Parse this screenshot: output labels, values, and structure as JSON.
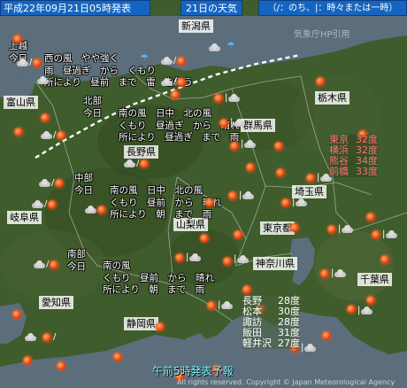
{
  "header": {
    "date": "平成22年09月21日05時発表",
    "day": "21日の天気",
    "legend": "（/：のち、|：時々または一時）"
  },
  "credit": "気象庁HP引用",
  "forecast_label": "午前5時発表予報",
  "copyright": "All rights reserved. Copyright © Japan Meteorological Agency",
  "prefectures": [
    "新潟県",
    "栃木県",
    "富山県",
    "群馬県",
    "長野県",
    "埼玉県",
    "岐阜県",
    "山梨県",
    "東京都",
    "神奈川県",
    "千葉県",
    "愛知県",
    "静岡県"
  ],
  "regions": [
    {
      "name": "上越\n今日",
      "text": "西の風　やや強く\n雨　昼過ぎ　から　くもり\n所により　昼前　まで　雷　を伴う"
    },
    {
      "name": "北部\n今日",
      "text": "南の風　日中　北の風\nくもり　昼過ぎ　から　晴れ\n所により　昼過ぎ　まで　雨"
    },
    {
      "name": "中部\n今日",
      "text": "南の風　日中　北の風\nくもり　昼前　から　晴れ\n所により　朝　まで　雨"
    },
    {
      "name": "南部\n今日",
      "text": "南の風\nくもり　昼前　から　晴れ\n所により　朝　まで　雨"
    }
  ],
  "temps_kanto": [
    {
      "city": "東京",
      "temp": "32度"
    },
    {
      "city": "横浜",
      "temp": "32度"
    },
    {
      "city": "熊谷",
      "temp": "34度"
    },
    {
      "city": "前橋",
      "temp": "33度"
    }
  ],
  "temps_nagano": [
    {
      "city": "長野",
      "temp": "28度"
    },
    {
      "city": "松本",
      "temp": "30度"
    },
    {
      "city": "諏訪",
      "temp": "28度"
    },
    {
      "city": "飯田",
      "temp": "31度"
    },
    {
      "city": "軽井沢",
      "temp": "27度"
    }
  ]
}
